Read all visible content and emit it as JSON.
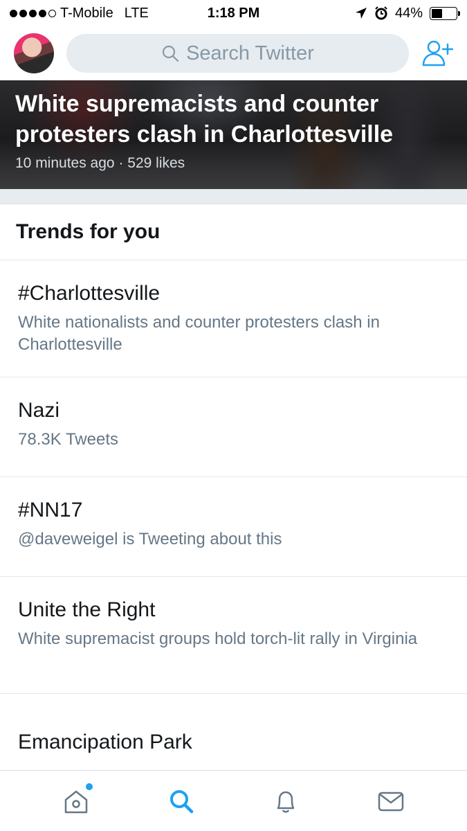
{
  "status_bar": {
    "carrier": "T-Mobile",
    "network": "LTE",
    "time": "1:18 PM",
    "battery_percent": "44%",
    "battery_level": 0.44,
    "signal_bars": 4
  },
  "search": {
    "placeholder": "Search Twitter",
    "icon": "search-icon"
  },
  "hero": {
    "title": "White supremacists and counter protesters clash in Charlottesville",
    "time_ago": "10 minutes ago",
    "separator": "·",
    "likes": "529 likes"
  },
  "trends": {
    "heading": "Trends for you",
    "items": [
      {
        "name": "#Charlottesville",
        "description": "White nationalists and counter protesters clash in Charlottesville"
      },
      {
        "name": "Nazi",
        "description": "78.3K Tweets"
      },
      {
        "name": "#NN17",
        "description": "@daveweigel is Tweeting about this"
      },
      {
        "name": "Unite the Right",
        "description": "White supremacist groups hold torch-lit rally in Virginia"
      },
      {
        "name": "Emancipation Park",
        "description": ""
      }
    ]
  },
  "tab_bar": {
    "tabs": [
      "home-icon",
      "search-icon",
      "notifications-icon",
      "messages-icon"
    ],
    "active": "search-icon",
    "accent_color": "#1da1f2",
    "inactive_color": "#657786"
  }
}
